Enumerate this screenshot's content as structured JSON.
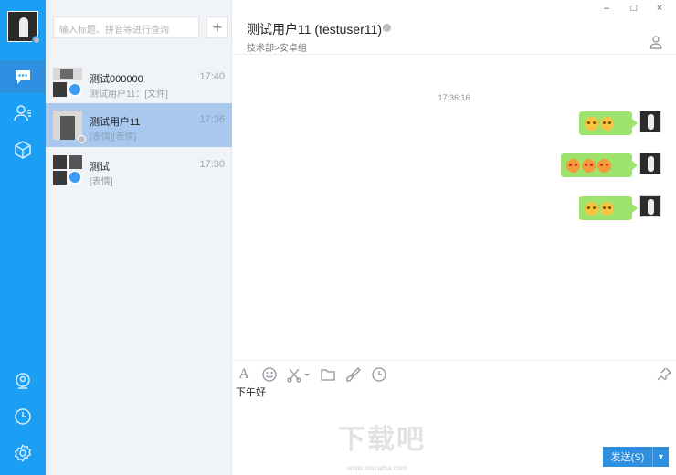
{
  "search": {
    "placeholder": "输入标题、拼音等进行查询"
  },
  "add_label": "+",
  "conversations": [
    {
      "name": "测试000000",
      "time": "17:40",
      "preview": "测试用户11：[文件]"
    },
    {
      "name": "测试用户11",
      "time": "17:36",
      "preview": "[表情][表情]"
    },
    {
      "name": "测试",
      "time": "17:30",
      "preview": "[表情]"
    }
  ],
  "chat": {
    "title": "测试用户11 (testuser11)",
    "subtitle": "技术部>安卓组",
    "timestamp": "17:36:16",
    "messages": [
      {
        "emoji_count": 2,
        "emoji_style": "yellow"
      },
      {
        "emoji_count": 3,
        "emoji_style": "red"
      },
      {
        "emoji_count": 2,
        "emoji_style": "yellow"
      }
    ]
  },
  "window_controls": {
    "minimize": "–",
    "maximize": "□",
    "close": "×"
  },
  "composer": {
    "draft": "下午好",
    "send_label": "发送(S)",
    "send_menu": "▾"
  },
  "watermark": {
    "text": "下载吧",
    "url": "www.xiazaiba.com"
  },
  "colors": {
    "rail": "#1a9ff5",
    "selected_row": "#a8c8ee",
    "bubble": "#9ee36e",
    "send": "#2f8fe0"
  }
}
